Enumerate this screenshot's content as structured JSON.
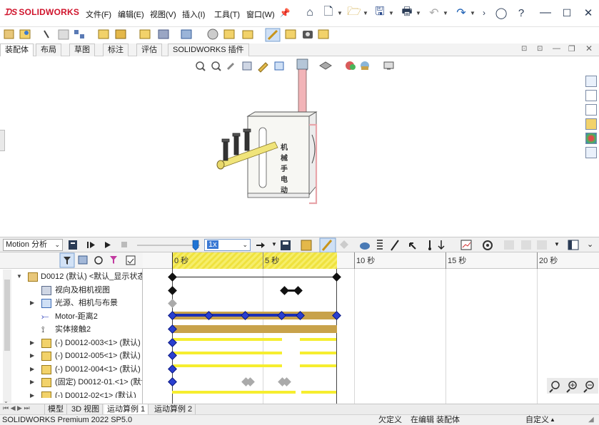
{
  "app": {
    "logo_text": "SOLIDWORKS",
    "menu": [
      "文件(F)",
      "编辑(E)",
      "视图(V)",
      "插入(I)",
      "工具(T)",
      "窗口(W)"
    ]
  },
  "command_tabs": [
    "装配体",
    "布局",
    "草图",
    "标注",
    "评估",
    "SOLIDWORKS 插件"
  ],
  "motion": {
    "study_type": "Motion 分析",
    "speed": "1x"
  },
  "timeline": {
    "tick_labels": [
      "0 秒",
      "5 秒",
      "10 秒",
      "15 秒",
      "20 秒"
    ],
    "seconds_per_major": 5
  },
  "tree": {
    "items": [
      {
        "label": "D0012 (默认) <默认_显示状态",
        "expander": "▼"
      },
      {
        "label": "视向及相机视图",
        "expander": ""
      },
      {
        "label": "光源、相机与布景",
        "expander": "▶"
      },
      {
        "label": "Motor-距离2",
        "expander": ""
      },
      {
        "label": "实体接触2",
        "expander": ""
      },
      {
        "label": "(-) D0012-003<1> (默认)",
        "expander": "▶"
      },
      {
        "label": "(-) D0012-005<1> (默认)",
        "expander": "▶"
      },
      {
        "label": "(-) D0012-004<1> (默认)",
        "expander": "▶"
      },
      {
        "label": "(固定) D0012-01.<1> (默认",
        "expander": "▶"
      },
      {
        "label": "(-) D0012-02<1> (默认)",
        "expander": "▶"
      }
    ]
  },
  "model_label": "机械手电动",
  "bottom_tabs": [
    "模型",
    "3D 视图",
    "运动算例 1",
    "运动算例 2"
  ],
  "status": {
    "left": "SOLIDWORKS Premium 2022 SP5.0",
    "s1": "欠定义",
    "s2": "在编辑 装配体",
    "s3": "自定义"
  },
  "colors": {
    "accent_blue": "#1b2fb5",
    "timeline_yellow": "#f6ee2f",
    "timeline_brown": "#c8a24a",
    "brand_red": "#d0142c"
  }
}
